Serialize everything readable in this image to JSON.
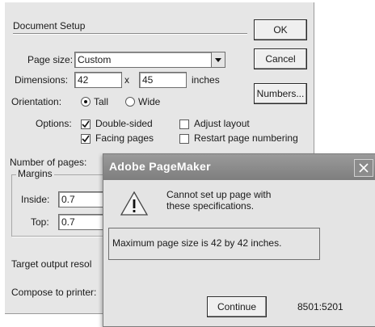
{
  "setup": {
    "title": "Document Setup",
    "ok_label": "OK",
    "cancel_label": "Cancel",
    "numbers_label": "Numbers...",
    "page_size_label": "Page size:",
    "page_size_value": "Custom",
    "dimensions_label": "Dimensions:",
    "width_value": "42",
    "times_symbol": "x",
    "height_value": "45",
    "units_label": "inches",
    "orientation_label": "Orientation:",
    "tall_label": "Tall",
    "wide_label": "Wide",
    "options_label": "Options:",
    "double_sided_label": "Double-sided",
    "facing_pages_label": "Facing pages",
    "adjust_layout_label": "Adjust layout",
    "restart_numbering_label": "Restart page numbering",
    "num_pages_label": "Number of pages:",
    "margins_label": "Margins",
    "inside_label": "Inside:",
    "inside_value": "0.7",
    "top_label": "Top:",
    "top_value": "0.7",
    "target_output_label": "Target output resol",
    "compose_label": "Compose to printer:"
  },
  "alert": {
    "title": "Adobe PageMaker",
    "message": "Cannot set up page with these specifications.",
    "detail": "Maximum page size is 42 by 42 inches.",
    "continue_label": "Continue",
    "error_code": "8501:5201"
  },
  "state": {
    "orientation": "Tall",
    "double_sided": true,
    "facing_pages": true,
    "adjust_layout": false,
    "restart_numbering": false
  },
  "icons": [
    "dropdown-arrow-icon",
    "checkmark-icon",
    "warning-icon",
    "close-icon"
  ]
}
